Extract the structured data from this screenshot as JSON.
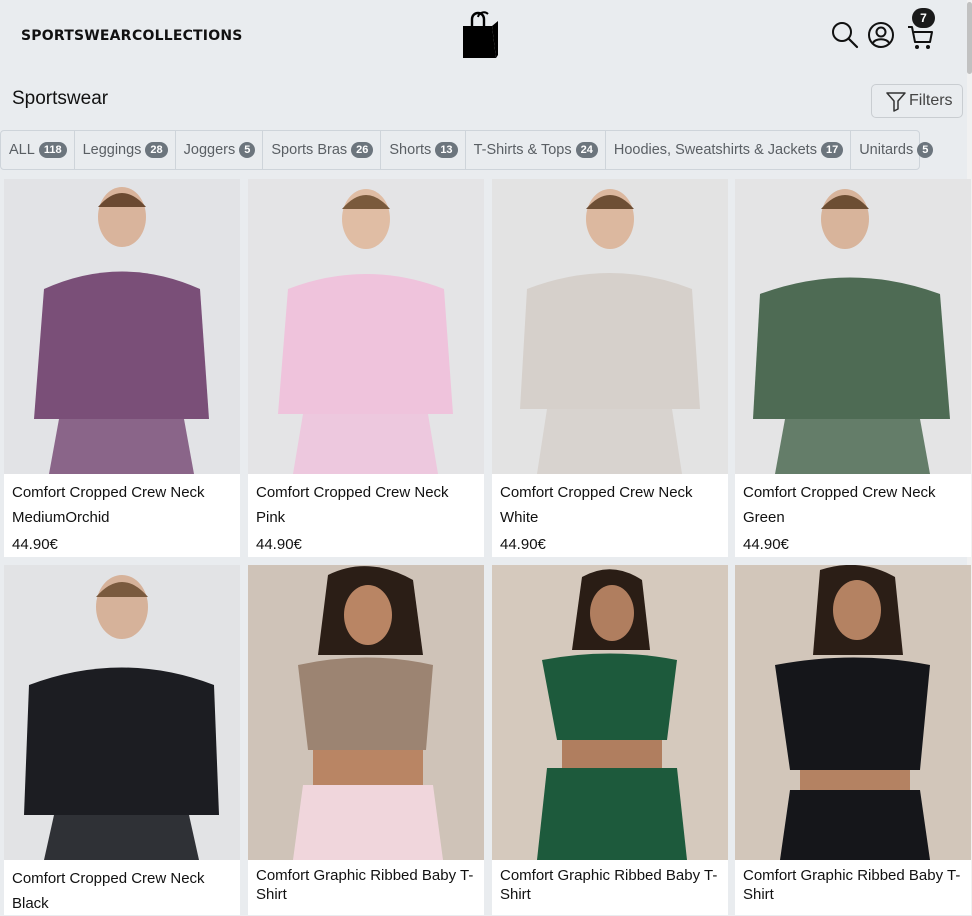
{
  "nav": {
    "links": [
      "SPORTSWEAR",
      "COLLECTIONS"
    ],
    "cart_count": "7"
  },
  "page": {
    "title": "Sportswear",
    "filters_label": "Filters"
  },
  "tabs": [
    {
      "label": "ALL",
      "count": "118"
    },
    {
      "label": "Leggings",
      "count": "28"
    },
    {
      "label": "Joggers",
      "count": "5"
    },
    {
      "label": "Sports Bras",
      "count": "26"
    },
    {
      "label": "Shorts",
      "count": "13"
    },
    {
      "label": "T-Shirts & Tops",
      "count": "24"
    },
    {
      "label": "Hoodies, Sweatshirts & Jackets",
      "count": "17"
    },
    {
      "label": "Unitards",
      "count": "5"
    }
  ],
  "products": [
    {
      "name": "Comfort Cropped Crew Neck MediumOrchid",
      "price": "44.90€",
      "color": "#7a4f78"
    },
    {
      "name": "Comfort Cropped Crew Neck Pink",
      "price": "44.90€",
      "color": "#efc3dc"
    },
    {
      "name": "Comfort Cropped Crew Neck White",
      "price": "44.90€",
      "color": "#d6d0cb"
    },
    {
      "name": "Comfort Cropped Crew Neck Green",
      "price": "44.90€",
      "color": "#4e6b54"
    },
    {
      "name": "Comfort Cropped Crew Neck Black",
      "price": "",
      "color": "#1c1d22"
    },
    {
      "name": "Comfort Graphic Ribbed Baby T-Shirt",
      "price": "",
      "color": "#9c8472"
    },
    {
      "name": "Comfort Graphic Ribbed Baby T-Shirt",
      "price": "",
      "color": "#1d5a3c"
    },
    {
      "name": "Comfort Graphic Ribbed Baby T-Shirt",
      "price": "",
      "color": "#15161a"
    }
  ]
}
